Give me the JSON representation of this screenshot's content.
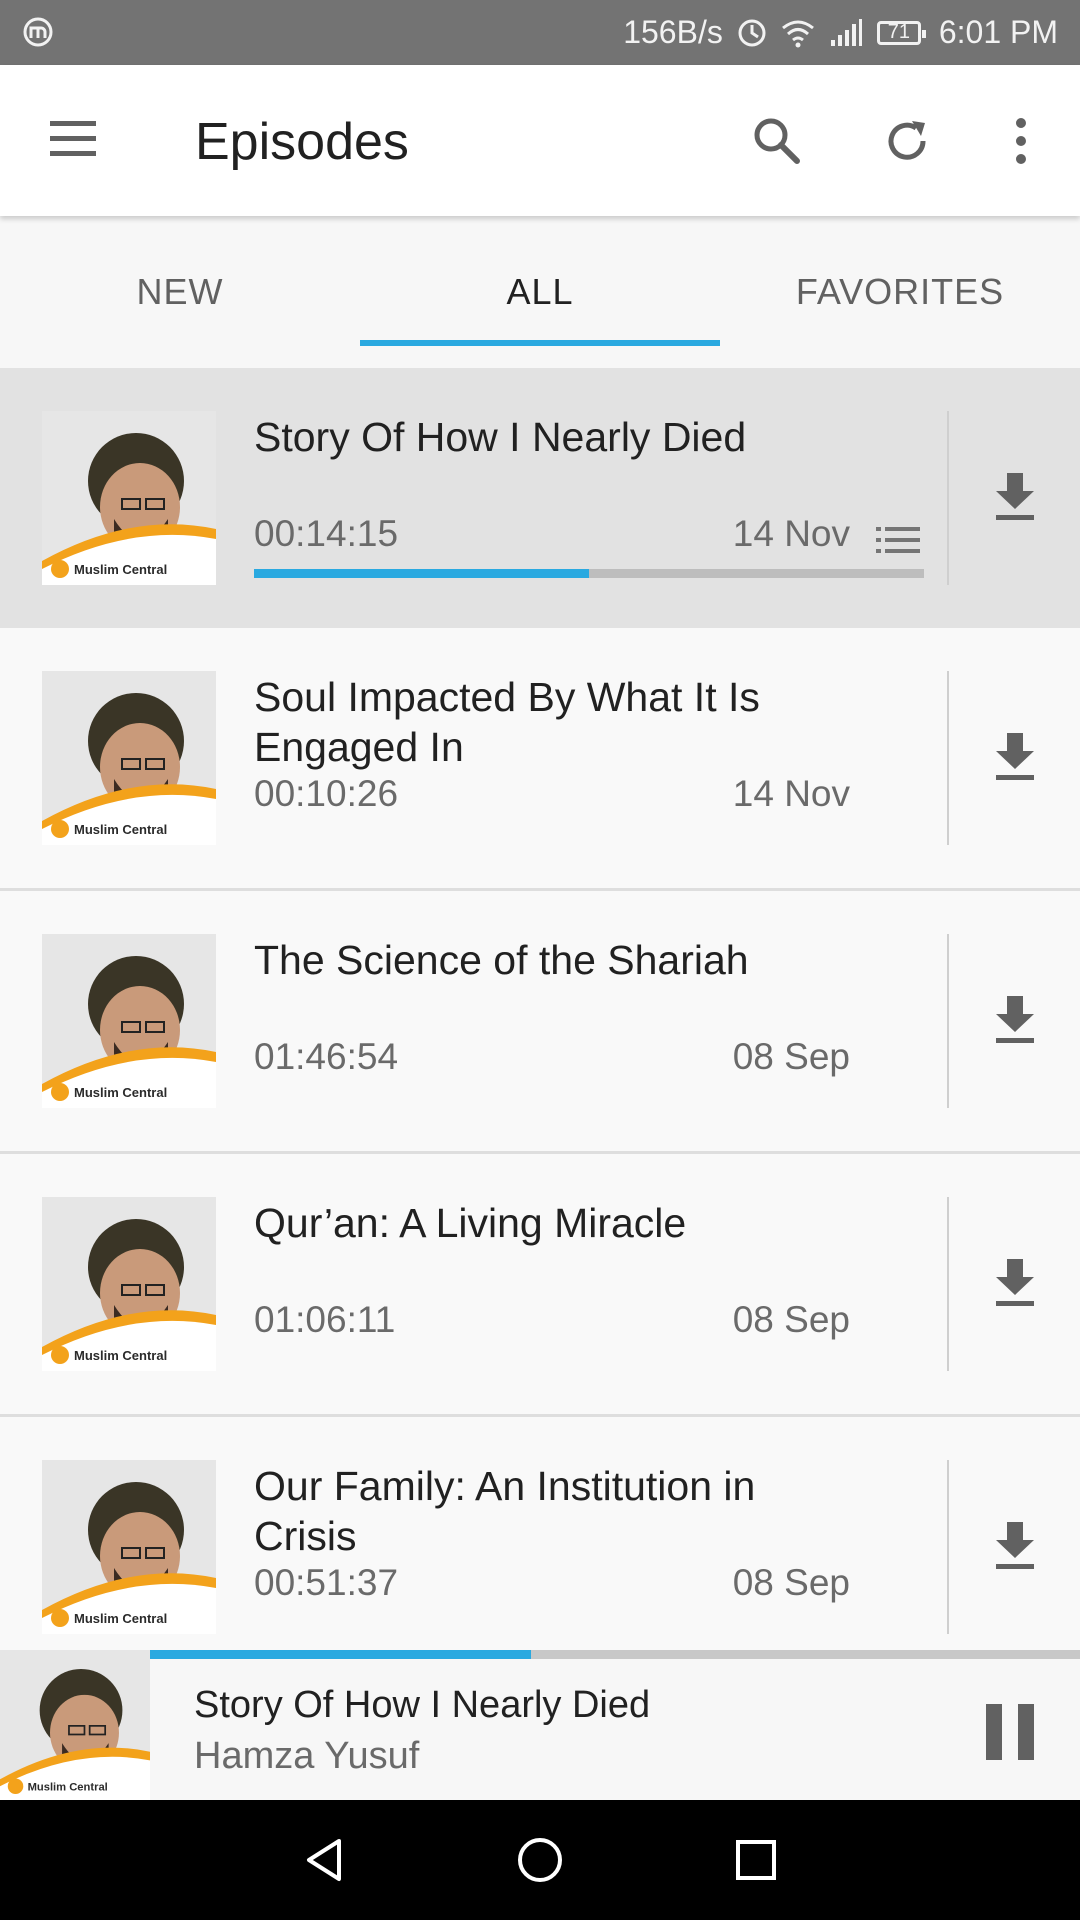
{
  "status_bar": {
    "speed": "156B/s",
    "battery": "71",
    "time": "6:01 PM"
  },
  "app_bar": {
    "title": "Episodes"
  },
  "tabs": [
    {
      "label": "NEW"
    },
    {
      "label": "ALL"
    },
    {
      "label": "FAVORITES"
    }
  ],
  "episodes": [
    {
      "title": "Story Of How I Nearly Died",
      "duration": "00:14:15",
      "date": "14 Nov",
      "progress": 0.5,
      "thumb_label": "Muslim Central"
    },
    {
      "title": "Soul Impacted By What It Is Engaged In",
      "duration": "00:10:26",
      "date": "14 Nov",
      "thumb_label": "Muslim Central"
    },
    {
      "title": "The Science of the Shariah",
      "duration": "01:46:54",
      "date": "08 Sep",
      "thumb_label": "Muslim Central"
    },
    {
      "title": "Qur’an: A Living Miracle",
      "duration": "01:06:11",
      "date": "08 Sep",
      "thumb_label": "Muslim Central"
    },
    {
      "title": "Our Family: An Institution in Crisis",
      "duration": "00:51:37",
      "date": "08 Sep",
      "thumb_label": "Muslim Central"
    }
  ],
  "player": {
    "title": "Story Of How I Nearly Died",
    "artist": "Hamza Yusuf",
    "progress": 0.41,
    "thumb_label": "Muslim Central"
  },
  "colors": {
    "accent": "#2aa9e0",
    "status_bar": "#737373",
    "nav_bar": "#000000"
  },
  "icons": {
    "menu": "hamburger-menu-icon",
    "search": "search-icon",
    "refresh": "refresh-icon",
    "more": "more-vert-icon",
    "download": "download-icon",
    "queue": "playlist-icon",
    "pause": "pause-icon",
    "back": "nav-back-icon",
    "home": "nav-home-icon",
    "recents": "nav-recents-icon"
  }
}
